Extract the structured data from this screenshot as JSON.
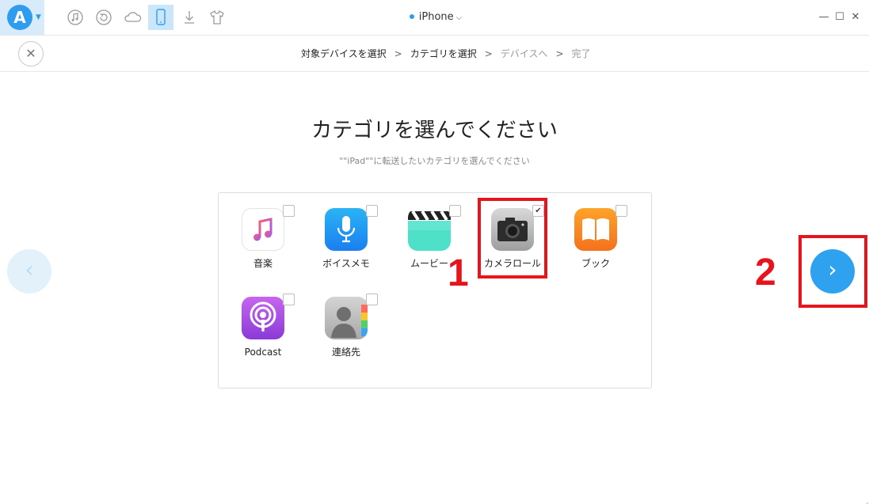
{
  "window": {
    "title": "iPhone",
    "title_status_color": "#2e9df0",
    "minimize": "—",
    "maximize": "☐",
    "close": "✕"
  },
  "toolbar": {
    "logo_letter": "A",
    "tools": [
      {
        "name": "music-icon"
      },
      {
        "name": "restore-icon"
      },
      {
        "name": "cloud-icon"
      },
      {
        "name": "device-icon",
        "active": true
      },
      {
        "name": "download-icon"
      },
      {
        "name": "tshirt-icon"
      }
    ]
  },
  "breadcrumb": {
    "steps": [
      "対象デバイスを選択",
      "カテゴリを選択",
      "デバイスへ",
      "完了"
    ],
    "separator": ">",
    "close_symbol": "✕"
  },
  "main": {
    "title": "カテゴリを選んでください",
    "subtitle": "\"\"iPad\"\"に転送したいカテゴリを選んでください"
  },
  "categories": [
    {
      "label": "音楽",
      "icon": "music-app-icon",
      "checked": false
    },
    {
      "label": "ボイスメモ",
      "icon": "voice-memo-icon",
      "checked": false
    },
    {
      "label": "ムービー",
      "icon": "movie-clapper-icon",
      "checked": false
    },
    {
      "label": "カメラロール",
      "icon": "camera-icon",
      "checked": true
    },
    {
      "label": "ブック",
      "icon": "book-icon",
      "checked": false
    },
    {
      "label": "Podcast",
      "icon": "podcast-icon",
      "checked": false
    },
    {
      "label": "連絡先",
      "icon": "contacts-icon",
      "checked": false
    }
  ],
  "nav": {
    "prev_symbol": "‹",
    "next_symbol": "›"
  },
  "annotations": {
    "step1": "1",
    "step2": "2",
    "color": "#e8141c"
  },
  "colors": {
    "accent": "#2ea2ee",
    "annotation": "#e8141c"
  }
}
